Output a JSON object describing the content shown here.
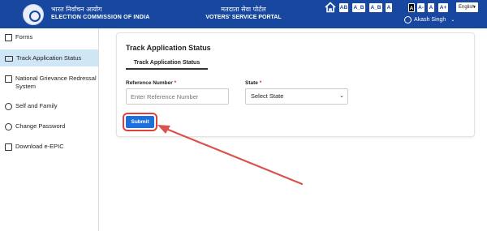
{
  "header": {
    "org_hindi": "भारत निर्वाचन आयोग",
    "org_english": "ELECTION COMMISSION OF INDIA",
    "portal_hindi": "मतदाता सेवा पोर्टल",
    "portal_english": "VOTERS' SERVICE PORTAL",
    "toolbar": [
      "AB",
      "A_B",
      "A_B",
      "A",
      "A",
      "A-",
      "A",
      "A+"
    ],
    "language": "English",
    "user_name": "Akash Singh",
    "colors": {
      "brand": "#17479e"
    }
  },
  "sidebar": {
    "items": [
      {
        "label": "Forms",
        "icon": "form-icon"
      },
      {
        "label": "Track Application Status",
        "icon": "truck-icon",
        "active": true
      },
      {
        "label": "National Grievance Redressal System",
        "icon": "document-icon"
      },
      {
        "label": "Self and Family",
        "icon": "family-icon"
      },
      {
        "label": "Change Password",
        "icon": "key-icon"
      },
      {
        "label": "Download e-EPIC",
        "icon": "download-icon"
      }
    ]
  },
  "main": {
    "title": "Track Application Status",
    "tab_label": "Track Application Status",
    "reference_label": "Reference Number",
    "reference_placeholder": "Enter Reference Number",
    "state_label": "State",
    "state_value": "Select State",
    "required_mark": "*",
    "submit_label": "Submit",
    "colors": {
      "submit": "#1d6fdc",
      "highlight": "#e0403a"
    }
  }
}
